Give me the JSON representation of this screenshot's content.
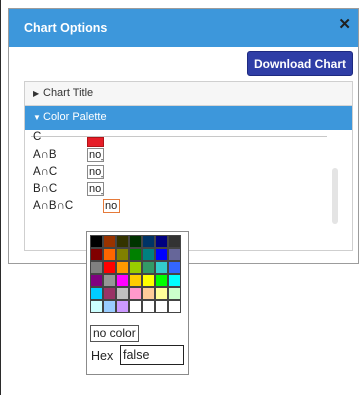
{
  "dialog": {
    "title": "Chart Options",
    "close_label": "✕",
    "download_label": "Download Chart"
  },
  "accordion": {
    "chart_title": {
      "label": "Chart Title",
      "collapsed_icon": "triangle-right-icon"
    },
    "color_palette": {
      "label": "Color Palette",
      "expanded_icon": "triangle-down-icon"
    }
  },
  "palette_rows": [
    {
      "label": "C",
      "value": "",
      "color": "#e61d28"
    },
    {
      "label": "A∩B",
      "value": "no_"
    },
    {
      "label": "A∩C",
      "value": "no_"
    },
    {
      "label": "B∩C",
      "value": "no_"
    },
    {
      "label": "A∩B∩C",
      "value": "no"
    }
  ],
  "color_picker": {
    "swatches": [
      [
        "#000000",
        "#993300",
        "#333300",
        "#003300",
        "#003366",
        "#000080",
        "#333333"
      ],
      [
        "#800000",
        "#ff6600",
        "#808000",
        "#008000",
        "#008080",
        "#0000ff",
        "#666699"
      ],
      [
        "#808080",
        "#ff0000",
        "#ff9900",
        "#99cc00",
        "#339966",
        "#33cccc",
        "#3366ff"
      ],
      [
        "#800080",
        "#969696",
        "#ff00ff",
        "#ffcc00",
        "#ffff00",
        "#00ff00",
        "#00ffff"
      ],
      [
        "#00ccff",
        "#993366",
        "#c0c0c0",
        "#ff99cc",
        "#ffcc99",
        "#ffff99",
        "#ccffcc"
      ],
      [
        "#ccffff",
        "#99ccff",
        "#cc99ff",
        "#ffffff",
        "#ffffff",
        "#ffffff",
        "#ffffff"
      ]
    ],
    "no_color_label": "no color",
    "hex_label": "Hex",
    "hex_value": "false"
  }
}
